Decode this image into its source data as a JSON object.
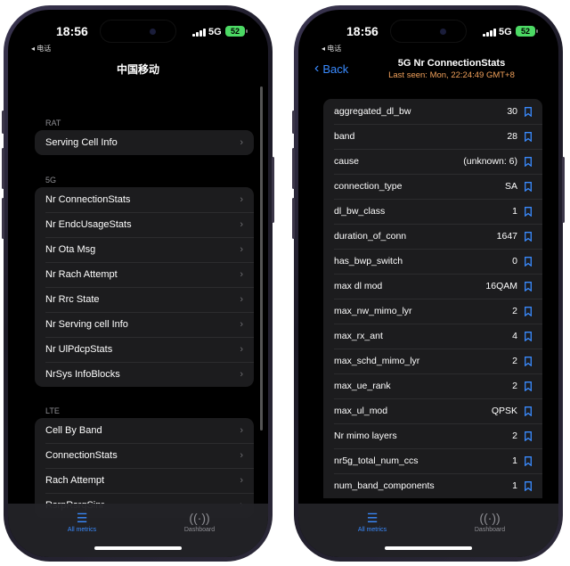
{
  "status": {
    "time": "18:56",
    "back_app": "◂ 电话",
    "network": "5G",
    "battery": "52"
  },
  "left": {
    "title": "中国移动",
    "sections": [
      {
        "label": "RAT",
        "items": [
          "Serving Cell Info"
        ]
      },
      {
        "label": "5G",
        "items": [
          "Nr ConnectionStats",
          "Nr EndcUsageStats",
          "Nr Ota Msg",
          "Nr Rach Attempt",
          "Nr Rrc State",
          "Nr Serving cell Info",
          "Nr UlPdcpStats",
          "NrSys InfoBlocks"
        ]
      },
      {
        "label": "LTE",
        "items": [
          "Cell By Band",
          "ConnectionStats",
          "Rach Attempt",
          "RsrpRsrqSinr"
        ]
      }
    ]
  },
  "right": {
    "back_label": "Back",
    "title": "5G Nr ConnectionStats",
    "subtitle": "Last seen: Mon, 22:24:49 GMT+8",
    "stats": [
      {
        "key": "aggregated_dl_bw",
        "value": "30"
      },
      {
        "key": "band",
        "value": "28"
      },
      {
        "key": "cause",
        "value": "(unknown: 6)"
      },
      {
        "key": "connection_type",
        "value": "SA"
      },
      {
        "key": "dl_bw_class",
        "value": "1"
      },
      {
        "key": "duration_of_conn",
        "value": "1647"
      },
      {
        "key": "has_bwp_switch",
        "value": "0"
      },
      {
        "key": "max dl mod",
        "value": "16QAM"
      },
      {
        "key": "max_nw_mimo_lyr",
        "value": "2"
      },
      {
        "key": "max_rx_ant",
        "value": "4"
      },
      {
        "key": "max_schd_mimo_lyr",
        "value": "2"
      },
      {
        "key": "max_ue_rank",
        "value": "2"
      },
      {
        "key": "max_ul_mod",
        "value": "QPSK"
      },
      {
        "key": "Nr mimo layers",
        "value": "2"
      },
      {
        "key": "nr5g_total_num_ccs",
        "value": "1"
      },
      {
        "key": "num_band_components",
        "value": "1"
      }
    ]
  },
  "tabs": [
    {
      "label": "All metrics",
      "icon": "list-icon",
      "active": true
    },
    {
      "label": "Dashboard",
      "icon": "antenna-icon",
      "active": false
    }
  ],
  "colors": {
    "accent": "#3a8bff",
    "subtitle": "#f0a05a",
    "battery": "#4cd964",
    "cell_bg": "#1c1c1e"
  }
}
